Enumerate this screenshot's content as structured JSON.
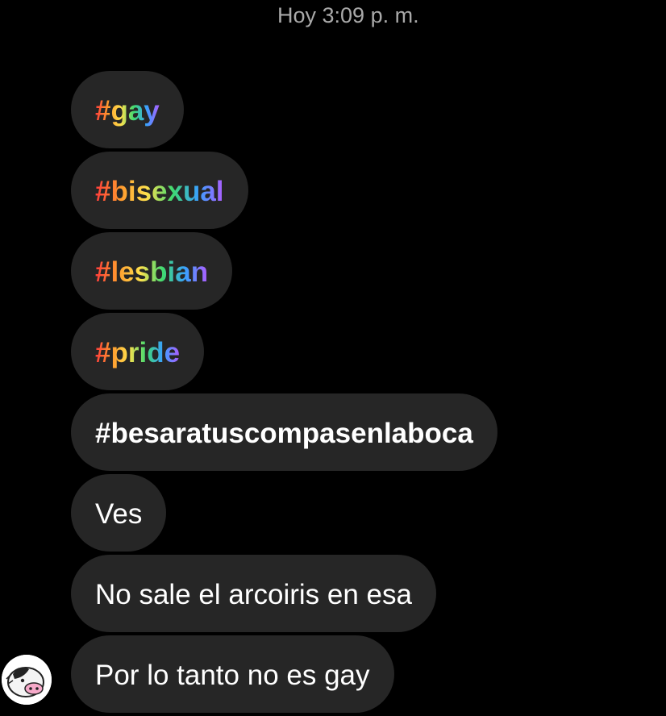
{
  "header": {
    "timestamp": "Hoy 3:09 p. m."
  },
  "messages": [
    {
      "text": "#gay",
      "style": "rainbow-hashtag"
    },
    {
      "text": "#bisexual",
      "style": "rainbow-hashtag"
    },
    {
      "text": "#lesbian",
      "style": "rainbow-hashtag"
    },
    {
      "text": "#pride",
      "style": "rainbow-hashtag"
    },
    {
      "text": "#besaratuscompasenlaboca",
      "style": "plain-hashtag"
    },
    {
      "text": "Ves",
      "style": "plain"
    },
    {
      "text": "No sale el arcoiris en esa",
      "style": "plain"
    },
    {
      "text": "Por lo tanto no es gay",
      "style": "plain"
    }
  ],
  "colors": {
    "background": "#000000",
    "bubble": "#262626",
    "timestamp": "#a9a9a9",
    "text": "#ffffff",
    "rainbow": [
      "#ff3b3b",
      "#ff9a2e",
      "#ffe14d",
      "#3fd970",
      "#3aa0ff",
      "#b05cff"
    ]
  },
  "icons": {
    "avatar": "cartoon-cow-avatar"
  }
}
